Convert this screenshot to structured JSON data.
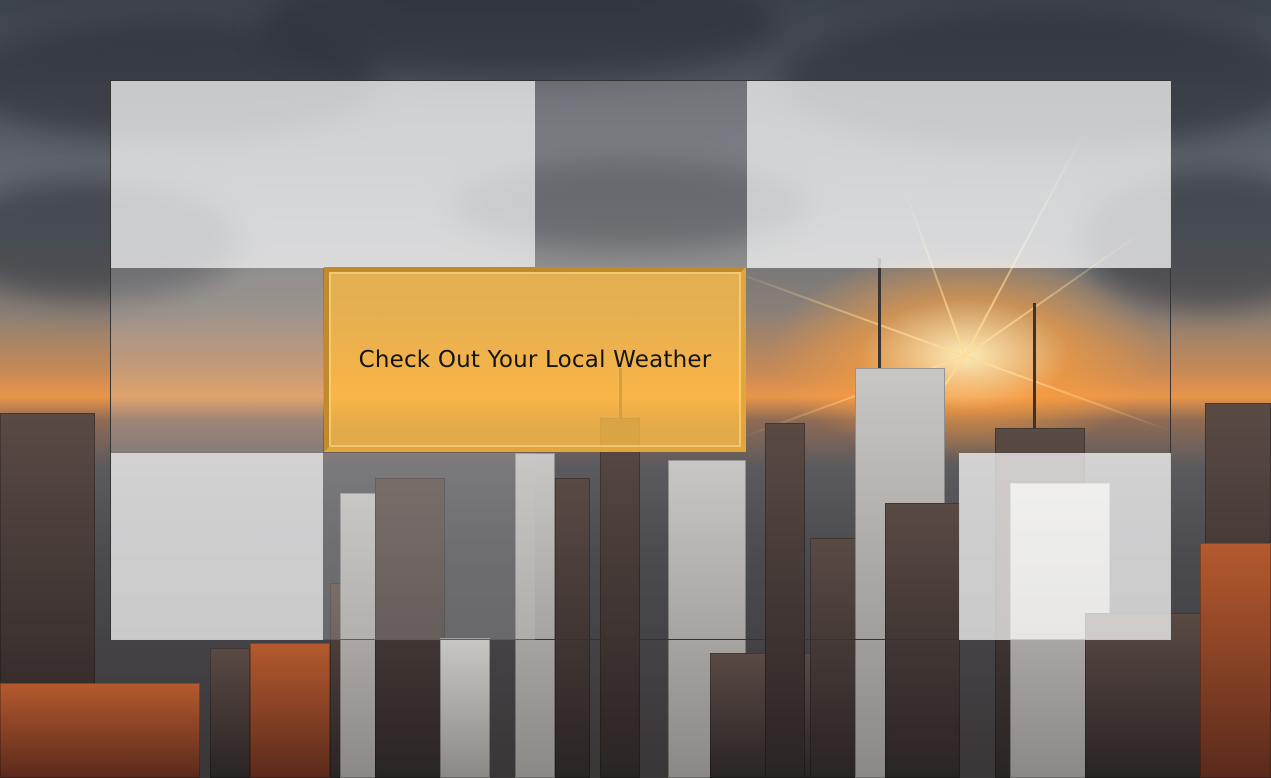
{
  "weather_tile": {
    "label": "Check Out Your Local Weather",
    "background_color": "#ffbe46",
    "border_color": "#c28a2a"
  },
  "grid": {
    "rows": 3,
    "columns": 5,
    "cells": [
      {
        "row": 1,
        "col": 1,
        "style": "bright"
      },
      {
        "row": 1,
        "col": 2,
        "style": "bright"
      },
      {
        "row": 1,
        "col": 3,
        "style": "dim"
      },
      {
        "row": 1,
        "col": 4,
        "style": "bright"
      },
      {
        "row": 1,
        "col": 5,
        "style": "bright"
      },
      {
        "row": 2,
        "col": 1,
        "style": "dim"
      },
      {
        "row": 2,
        "col": 4,
        "style": "clear"
      },
      {
        "row": 2,
        "col": 5,
        "style": "clear"
      },
      {
        "row": 3,
        "col": 1,
        "style": "bright"
      },
      {
        "row": 3,
        "col": 2,
        "style": "dim"
      },
      {
        "row": 3,
        "col": 3,
        "style": "clear"
      },
      {
        "row": 3,
        "col": 4,
        "style": "clear"
      },
      {
        "row": 3,
        "col": 5,
        "style": "bright"
      }
    ]
  },
  "background": {
    "scene": "city-skyline-sunset-photo"
  }
}
